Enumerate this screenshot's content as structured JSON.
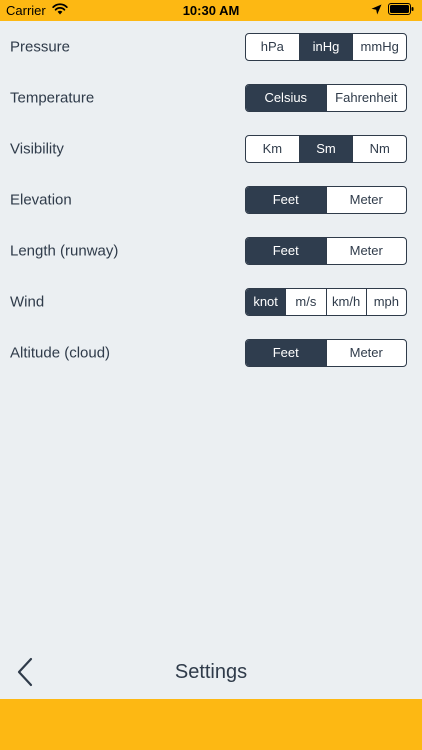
{
  "status_bar": {
    "carrier": "Carrier",
    "time": "10:30 AM",
    "icons": [
      "wifi-icon",
      "location-arrow-icon",
      "battery-icon"
    ]
  },
  "settings": [
    {
      "label": "Pressure",
      "options": [
        "hPa",
        "inHg",
        "mmHg"
      ],
      "selected": 1
    },
    {
      "label": "Temperature",
      "options": [
        "Celsius",
        "Fahrenheit"
      ],
      "selected": 0
    },
    {
      "label": "Visibility",
      "options": [
        "Km",
        "Sm",
        "Nm"
      ],
      "selected": 1
    },
    {
      "label": "Elevation",
      "options": [
        "Feet",
        "Meter"
      ],
      "selected": 0
    },
    {
      "label": "Length (runway)",
      "options": [
        "Feet",
        "Meter"
      ],
      "selected": 0
    },
    {
      "label": "Wind",
      "options": [
        "knot",
        "m/s",
        "km/h",
        "mph"
      ],
      "selected": 0
    },
    {
      "label": "Altitude (cloud)",
      "options": [
        "Feet",
        "Meter"
      ],
      "selected": 0
    }
  ],
  "nav": {
    "title": "Settings",
    "back_icon": "chevron-left-icon"
  },
  "colors": {
    "accent": "#fdb813",
    "selected": "#2f3d4e",
    "background": "#ebeff2",
    "text": "#2f3b4a"
  }
}
